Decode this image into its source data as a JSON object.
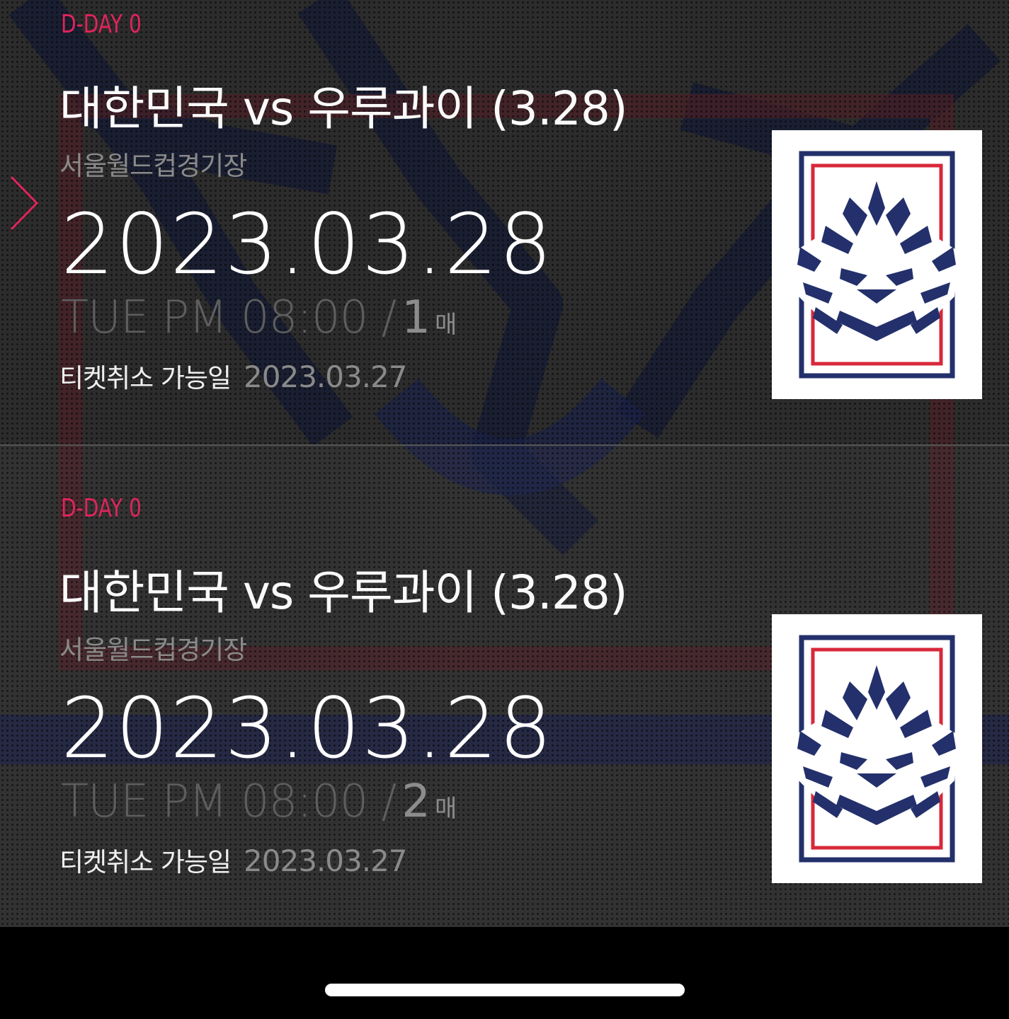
{
  "tickets": [
    {
      "dday": "D-DAY 0",
      "title": "대한민국 vs 우루과이 (3.28)",
      "venue": "서울월드컵경기장",
      "date": "2023.03.28",
      "time": "TUE PM 08:00 /",
      "count": "1",
      "count_unit": "매",
      "cancel_label": "티켓취소 가능일",
      "cancel_date": "2023.03.27",
      "logo_icon": "korea-tiger-emblem"
    },
    {
      "dday": "D-DAY 0",
      "title": "대한민국 vs 우루과이 (3.28)",
      "venue": "서울월드컵경기장",
      "date": "2023.03.28",
      "time": "TUE PM 08:00 /",
      "count": "2",
      "count_unit": "매",
      "cancel_label": "티켓취소 가능일",
      "cancel_date": "2023.03.27",
      "logo_icon": "korea-tiger-emblem"
    }
  ],
  "colors": {
    "accent": "#e0245c",
    "background": "#2c2c2c",
    "emblem_navy": "#23306b",
    "emblem_red": "#d8283a"
  },
  "icons": {
    "selection_arrow": "chevron-right-icon"
  }
}
